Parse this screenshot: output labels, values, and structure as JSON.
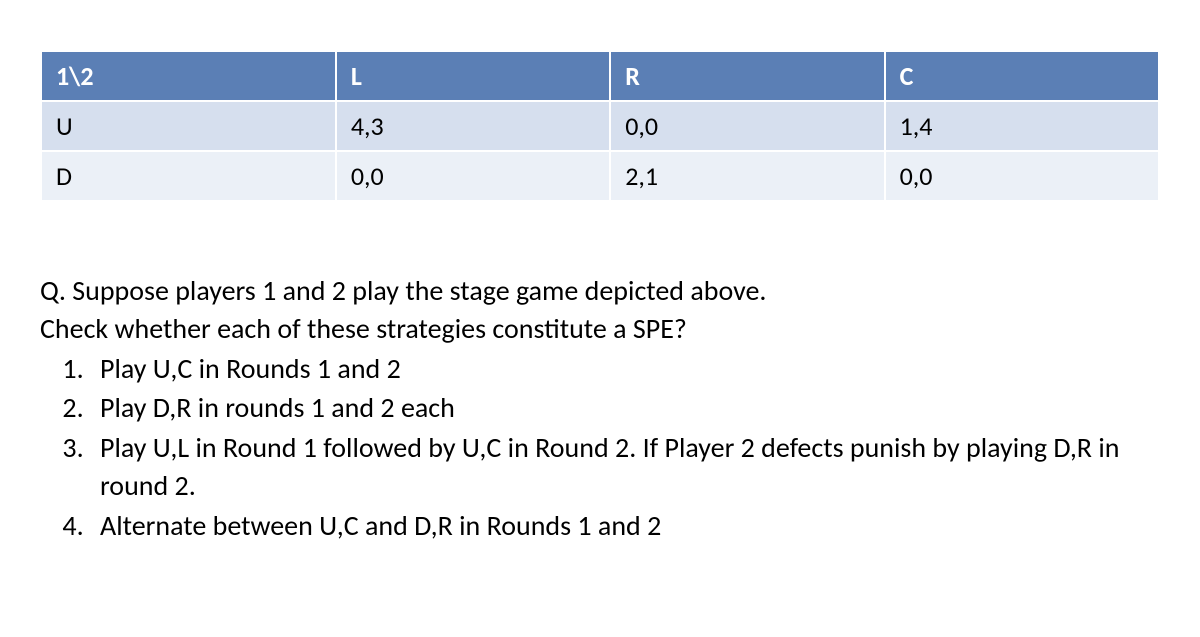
{
  "table": {
    "corner": "1\\2",
    "columns": [
      "L",
      "R",
      "C"
    ],
    "rows": [
      {
        "label": "U",
        "cells": [
          "4,3",
          "0,0",
          "1,4"
        ]
      },
      {
        "label": "D",
        "cells": [
          "0,0",
          "2,1",
          "0,0"
        ]
      }
    ]
  },
  "question": {
    "intro_line1": "Q. Suppose players 1 and 2 play the stage game depicted above.",
    "intro_line2": "Check whether each of these strategies constitute a SPE?",
    "items": [
      "Play U,C in Rounds 1 and 2",
      "Play D,R in rounds 1 and 2 each",
      "Play U,L in Round 1 followed by U,C in Round 2. If Player 2 defects punish by playing D,R in round 2.",
      "Alternate between U,C and D,R in Rounds 1 and 2"
    ]
  },
  "colors": {
    "header_bg": "#5B7FB5",
    "row_odd_bg": "#D6DFEE",
    "row_even_bg": "#EBF0F7"
  }
}
